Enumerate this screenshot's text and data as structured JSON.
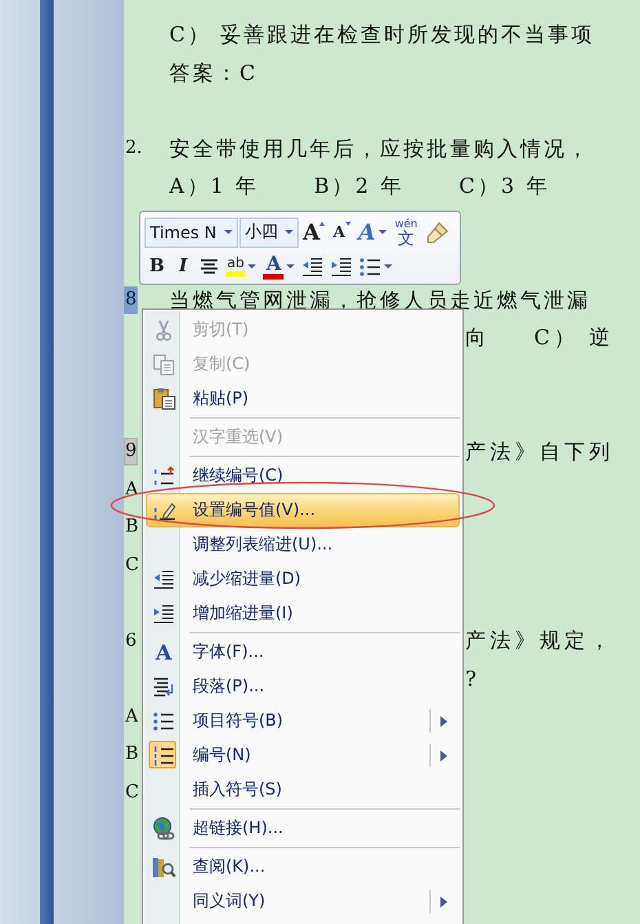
{
  "document": {
    "paragraphs": [
      {
        "lines": [
          {
            "texts": [
              "C） 妥善跟进在检查时所发现的不当事项"
            ]
          },
          {
            "texts": [
              "答案：C"
            ]
          }
        ]
      },
      {
        "lines": [
          {
            "lead": "2.",
            "selected": false,
            "shaded": false,
            "texts": [
              "安全带使用几年后，应按批量购入情况，"
            ]
          },
          {
            "texts": [
              "A）1 年",
              "B）2 年",
              "C）3 年"
            ]
          }
        ]
      },
      {
        "lines": [
          {
            "lead": "8",
            "selected": true,
            "shaded": false,
            "texts": [
              "当燃气管网泄漏，抢修人员走近燃气泄漏"
            ]
          },
          {
            "tail": [
              "向",
              "C） 逆"
            ]
          }
        ]
      },
      {
        "lines": [
          {
            "lead": "9",
            "selected": false,
            "shaded": true,
            "tail": [
              "产法》自下列"
            ]
          },
          {
            "lead": "A",
            "selected": false,
            "shaded": false
          },
          {
            "lead": "B",
            "selected": false,
            "shaded": false
          },
          {
            "lead": "C",
            "selected": false,
            "shaded": false
          }
        ]
      },
      {
        "lines": [
          {
            "lead": "6",
            "selected": false,
            "shaded": false,
            "tail": [
              "产法》规定，"
            ]
          },
          {
            "tail": [
              "?"
            ]
          },
          {
            "lead": "A",
            "selected": false,
            "shaded": false
          },
          {
            "lead": "B",
            "selected": false,
            "shaded": false
          },
          {
            "lead": "C",
            "selected": false,
            "shaded": false
          }
        ]
      }
    ]
  },
  "mini_toolbar": {
    "font_name": "Times N",
    "font_size": "小四",
    "row_1": [
      {
        "kind": "grow",
        "glyph": "A"
      },
      {
        "kind": "shrink",
        "glyph": "A"
      },
      {
        "kind": "styles",
        "glyph": "A"
      },
      {
        "kind": "phonetic",
        "glyph": "wén",
        "sub": "文"
      },
      {
        "kind": "painter"
      }
    ],
    "row_2": [
      {
        "kind": "bold",
        "glyph": "B"
      },
      {
        "kind": "italic",
        "glyph": "I"
      },
      {
        "kind": "center"
      },
      {
        "kind": "highlight",
        "glyph": "ab"
      },
      {
        "kind": "color",
        "glyph": "A"
      },
      {
        "kind": "outdent"
      },
      {
        "kind": "indent"
      },
      {
        "kind": "bullets"
      }
    ]
  },
  "context_menu": {
    "items": [
      {
        "kind": "cut",
        "label": "剪切(T)",
        "disabled": true,
        "selected": false,
        "checked": false,
        "submenu": false
      },
      {
        "kind": "copy",
        "label": "复制(C)",
        "disabled": true,
        "selected": false,
        "checked": false,
        "submenu": false
      },
      {
        "kind": "paste",
        "label": "粘贴(P)",
        "disabled": false,
        "selected": false,
        "checked": false,
        "submenu": false
      },
      {
        "kind": "separator"
      },
      {
        "kind": "plain",
        "label": "汉字重选(V)",
        "disabled": true,
        "selected": false,
        "checked": false,
        "submenu": false
      },
      {
        "kind": "separator"
      },
      {
        "kind": "continue",
        "label": "继续编号(C)",
        "disabled": false,
        "selected": false,
        "checked": false,
        "submenu": false
      },
      {
        "kind": "setvalue",
        "label": "设置编号值(V)...",
        "disabled": false,
        "selected": true,
        "checked": false,
        "submenu": false
      },
      {
        "kind": "plain",
        "label": "调整列表缩进(U)...",
        "disabled": false,
        "selected": false,
        "checked": false,
        "submenu": false
      },
      {
        "kind": "outdent",
        "label": "减少缩进量(D)",
        "disabled": false,
        "selected": false,
        "checked": false,
        "submenu": false
      },
      {
        "kind": "indent",
        "label": "增加缩进量(I)",
        "disabled": false,
        "selected": false,
        "checked": false,
        "submenu": false
      },
      {
        "kind": "separator"
      },
      {
        "kind": "font",
        "glyph": "A",
        "label": "字体(F)...",
        "disabled": false,
        "selected": false,
        "checked": false,
        "submenu": false
      },
      {
        "kind": "paragraph",
        "label": "段落(P)...",
        "disabled": false,
        "selected": false,
        "checked": false,
        "submenu": false
      },
      {
        "kind": "bullets",
        "label": "项目符号(B)",
        "disabled": false,
        "selected": false,
        "checked": false,
        "submenu": true
      },
      {
        "kind": "numbering",
        "label": "编号(N)",
        "disabled": false,
        "selected": false,
        "checked": true,
        "submenu": true
      },
      {
        "kind": "plain",
        "label": "插入符号(S)",
        "disabled": false,
        "selected": false,
        "checked": false,
        "submenu": false
      },
      {
        "kind": "separator"
      },
      {
        "kind": "hyperlink",
        "label": "超链接(H)...",
        "disabled": false,
        "selected": false,
        "checked": false,
        "submenu": false
      },
      {
        "kind": "separator"
      },
      {
        "kind": "research",
        "label": "查阅(K)...",
        "disabled": false,
        "selected": false,
        "checked": false,
        "submenu": false
      },
      {
        "kind": "plain",
        "label": "同义词(Y)",
        "disabled": false,
        "selected": false,
        "checked": false,
        "submenu": true
      }
    ]
  }
}
